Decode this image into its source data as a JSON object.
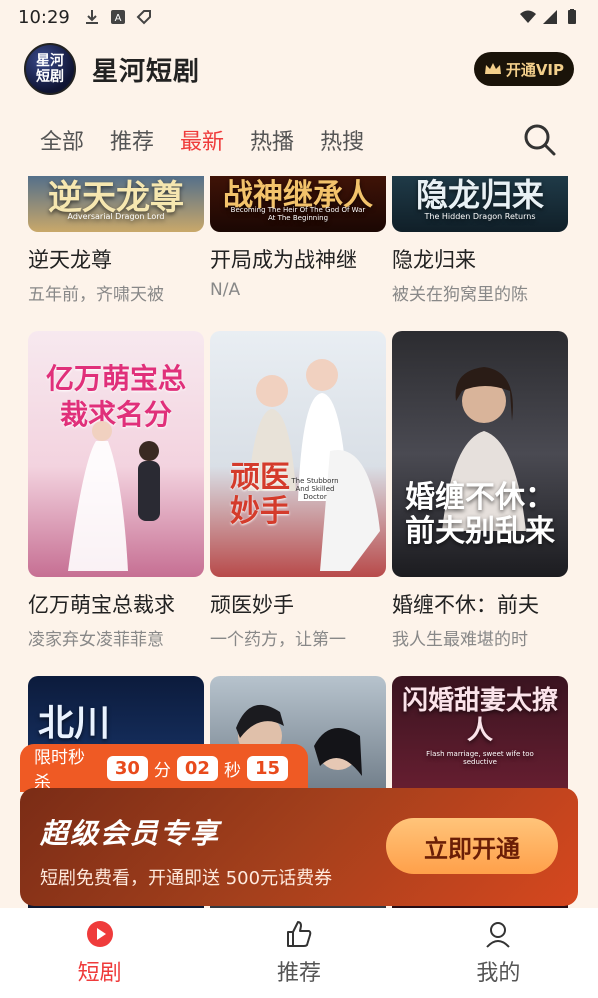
{
  "status_bar": {
    "time": "10:29"
  },
  "header": {
    "logo_text": "星河\n短剧",
    "app_title": "星河短剧",
    "vip_label": "开通VIP"
  },
  "tabs": [
    {
      "label": "全部"
    },
    {
      "label": "推荐"
    },
    {
      "label": "最新"
    },
    {
      "label": "热播"
    },
    {
      "label": "热搜"
    }
  ],
  "active_tab": "最新",
  "dramas": [
    {
      "title": "逆天龙尊",
      "desc": "五年前，齐啸天被",
      "poster_text": "逆天龙尊",
      "poster_subtitle": "Adversarial Dragon Lord"
    },
    {
      "title": "开局成为战神继",
      "desc": "N/A",
      "poster_text": "战神继承人",
      "poster_subtitle": "Becoming The Heir Of The God Of War At The Beginning"
    },
    {
      "title": "隐龙归来",
      "desc": "被关在狗窝里的陈",
      "poster_text": "隐龙归来",
      "poster_subtitle": "The Hidden Dragon Returns"
    },
    {
      "title": "亿万萌宝总裁求",
      "desc": "凌家弃女凌菲菲意",
      "poster_text": "亿万萌宝总裁求名分",
      "poster_subtitle": ""
    },
    {
      "title": "顽医妙手",
      "desc": "一个药方，让第一",
      "poster_text": "顽医妙手",
      "poster_subtitle": "The Stubborn And Skilled Doctor"
    },
    {
      "title": "婚缠不休：前夫",
      "desc": "我人生最难堪的时",
      "poster_text": "婚缠不休：前夫别乱来",
      "poster_subtitle": ""
    },
    {
      "title": "",
      "desc": "",
      "poster_text": "北川",
      "poster_subtitle": ""
    },
    {
      "title": "",
      "desc": "",
      "poster_text": "",
      "poster_subtitle": ""
    },
    {
      "title": "",
      "desc": "",
      "poster_text": "闪婚甜妻太撩人",
      "poster_subtitle": "Flash marriage, sweet wife too seductive"
    }
  ],
  "promo": {
    "countdown_label": "限时秒杀",
    "hours": "30",
    "unit_minute": "分",
    "minutes": "02",
    "unit_second": "秒",
    "seconds": "15",
    "title": "超级会员专享",
    "subtitle": "短剧免费看，开通即送 500元话费券",
    "button": "立即开通"
  },
  "bottom_nav": [
    {
      "label": "短剧",
      "icon": "play-circle-icon"
    },
    {
      "label": "推荐",
      "icon": "thumbs-up-icon"
    },
    {
      "label": "我的",
      "icon": "user-icon"
    }
  ],
  "colors": {
    "accent": "#ef3b3b",
    "promo_orange": "#ef5a24",
    "vip_gold": "#f3cf8b"
  }
}
